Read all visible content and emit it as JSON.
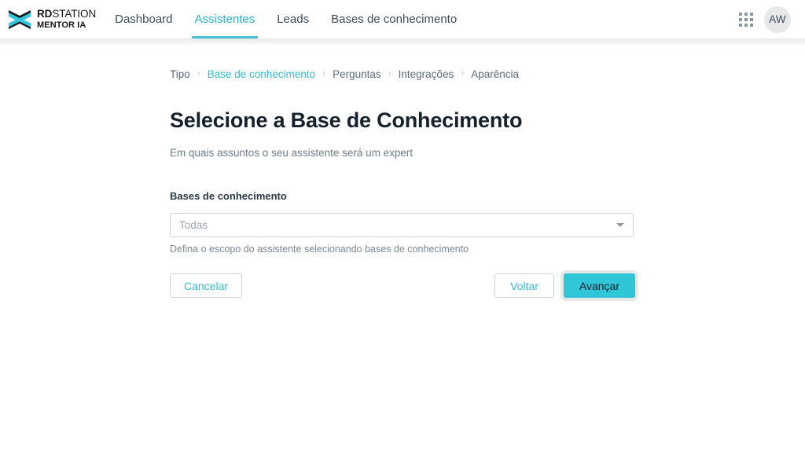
{
  "header": {
    "brand": {
      "logo_icon": "rd-station-chevron-logo",
      "line1_bold": "RD",
      "line1_regular": "STATION",
      "line2": "MENTOR IA"
    },
    "nav": [
      {
        "label": "Dashboard",
        "active": false
      },
      {
        "label": "Assistentes",
        "active": true
      },
      {
        "label": "Leads",
        "active": false
      },
      {
        "label": "Bases de conhecimento",
        "active": false
      }
    ],
    "apps_icon": "apps-grid-icon",
    "avatar_initials": "AW"
  },
  "breadcrumb": {
    "separator": "›",
    "items": [
      {
        "label": "Tipo",
        "active": false
      },
      {
        "label": "Base de conhecimento",
        "active": true
      },
      {
        "label": "Perguntas",
        "active": false
      },
      {
        "label": "Integrações",
        "active": false
      },
      {
        "label": "Aparência",
        "active": false
      }
    ]
  },
  "main": {
    "title": "Selecione a Base de Conhecimento",
    "subtitle": "Em quais assuntos o seu assistente será um expert",
    "field": {
      "label": "Bases de conhecimento",
      "selected_value": "Todas",
      "caret_icon": "chevron-down-icon",
      "help_text": "Defina o escopo do assistente selecionando bases de conhecimento"
    },
    "buttons": {
      "cancel": "Cancelar",
      "back": "Voltar",
      "next": "Avançar"
    }
  },
  "colors": {
    "accent": "#2fc6d8",
    "accent_text": "#35bccf",
    "nav_underline": "#43c0d6",
    "text_dark": "#16212b",
    "text_muted": "#6d7c8a",
    "border": "#ccd3da"
  }
}
